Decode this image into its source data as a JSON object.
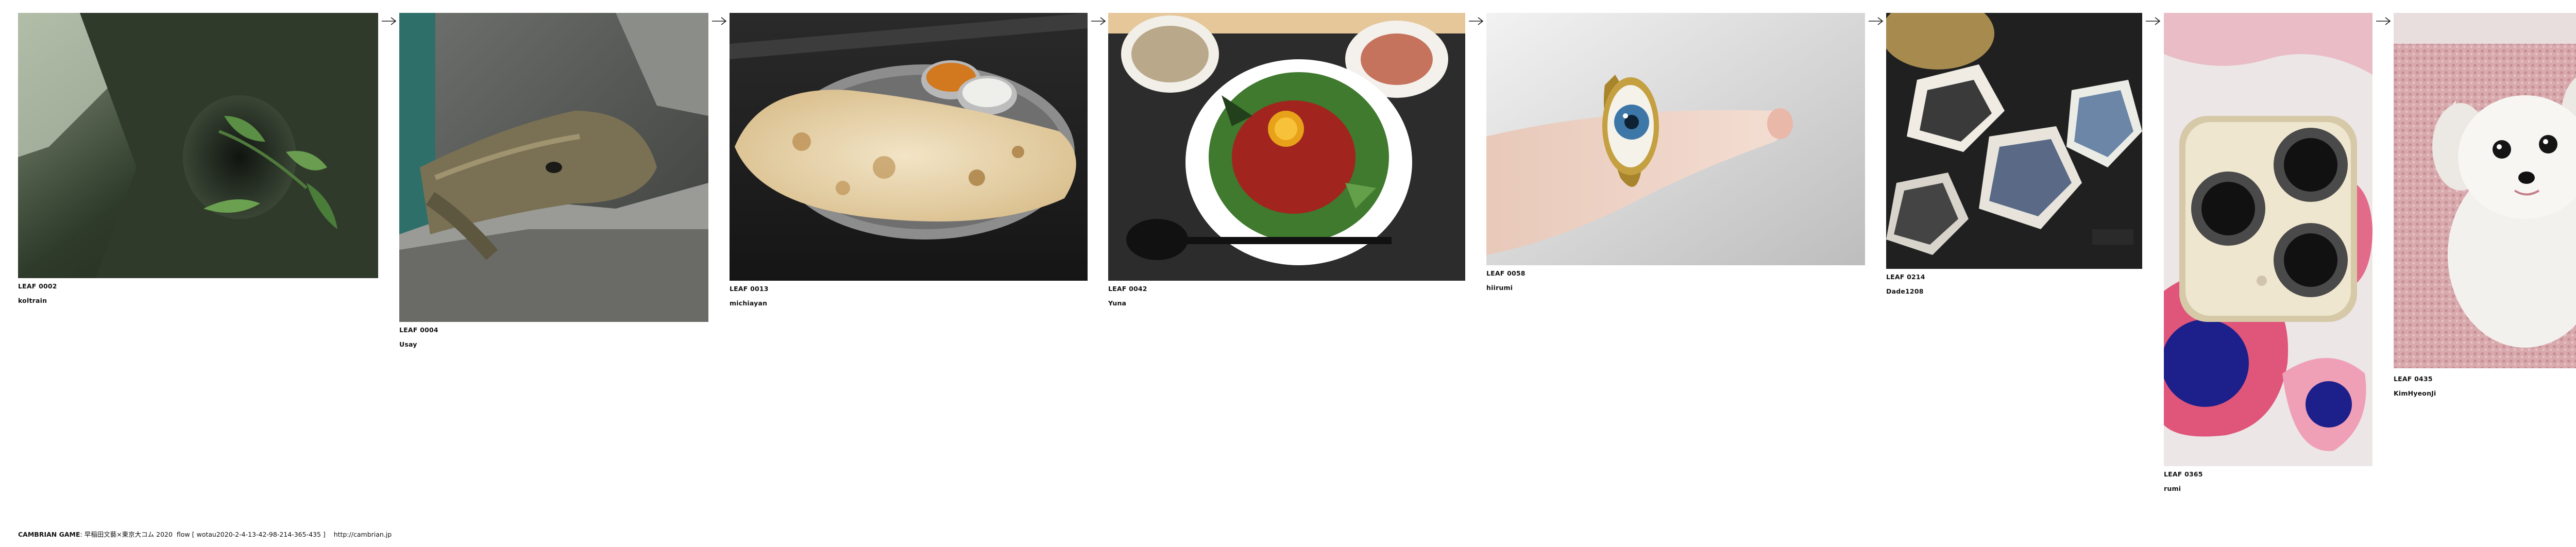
{
  "items": [
    {
      "code": "LEAF 0002",
      "author": "koltrain"
    },
    {
      "code": "LEAF 0004",
      "author": "Usay"
    },
    {
      "code": "LEAF 0013",
      "author": "michiayan"
    },
    {
      "code": "LEAF 0042",
      "author": "Yuna"
    },
    {
      "code": "LEAF 0058",
      "author": "hiirumi"
    },
    {
      "code": "LEAF 0214",
      "author": "Dade1208"
    },
    {
      "code": "LEAF 0365",
      "author": "rumi"
    },
    {
      "code": "LEAF 0435",
      "author": "KimHyeonJi"
    }
  ],
  "arrow_glyph": "→",
  "footer": {
    "brand": "CAMBRIAN GAME",
    "credit": "早稲田文藝×東京大コム 2020",
    "flow": "flow [ wotau2020-2-4-13-42-98-214-365-435 ]",
    "url": "http://cambrian.jp"
  },
  "colors": {
    "background": "#ffffff",
    "text": "#111111"
  }
}
